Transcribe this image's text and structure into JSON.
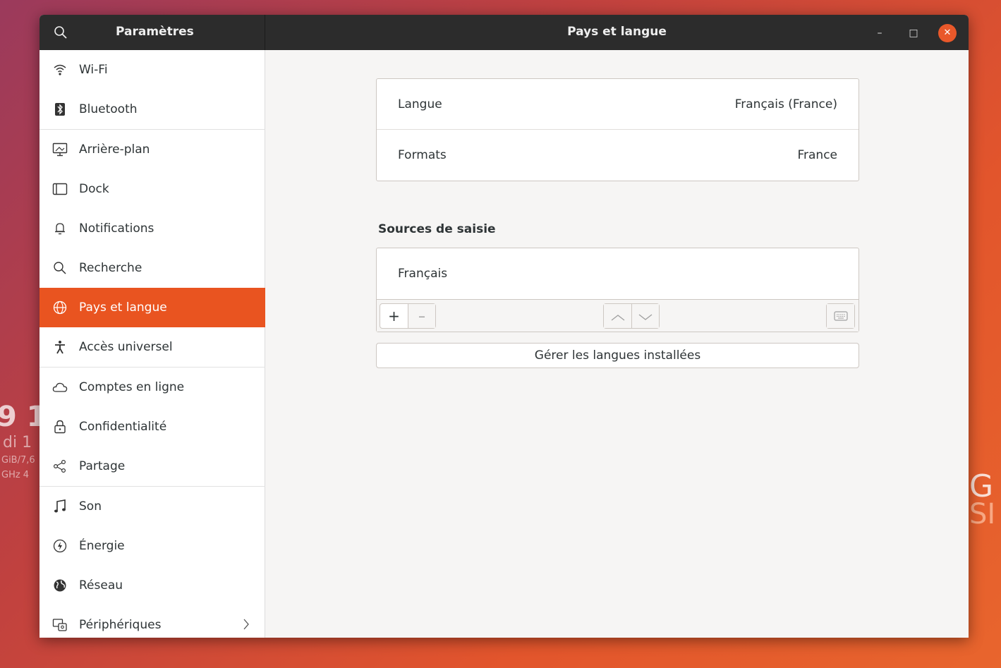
{
  "desktop": {
    "clock_fragment": "9 1",
    "date_fragment": "di 1",
    "mem_fragment": "GiB/7,6",
    "cpu_fragment": "GHz 4",
    "logo_fragment": "G",
    "logo_fragment2": "SI"
  },
  "headerbar": {
    "app_title": "Paramètres",
    "page_title": "Pays et langue",
    "min_label": "–",
    "max_label": "□",
    "close_label": "✕"
  },
  "sidebar": {
    "items": [
      {
        "label": "Wi-Fi",
        "icon": "wifi-icon"
      },
      {
        "label": "Bluetooth",
        "icon": "bluetooth-icon"
      },
      {
        "label": "Arrière-plan",
        "icon": "background-icon"
      },
      {
        "label": "Dock",
        "icon": "dock-icon"
      },
      {
        "label": "Notifications",
        "icon": "bell-icon"
      },
      {
        "label": "Recherche",
        "icon": "search-icon"
      },
      {
        "label": "Pays et langue",
        "icon": "globe-icon",
        "active": true
      },
      {
        "label": "Accès universel",
        "icon": "accessibility-icon"
      },
      {
        "label": "Comptes en ligne",
        "icon": "cloud-icon"
      },
      {
        "label": "Confidentialité",
        "icon": "lock-icon"
      },
      {
        "label": "Partage",
        "icon": "share-icon"
      },
      {
        "label": "Son",
        "icon": "music-note-icon"
      },
      {
        "label": "Énergie",
        "icon": "power-icon"
      },
      {
        "label": "Réseau",
        "icon": "network-globe-icon"
      },
      {
        "label": "Périphériques",
        "icon": "devices-icon"
      }
    ]
  },
  "region": {
    "language_label": "Langue",
    "language_value": "Français (France)",
    "formats_label": "Formats",
    "formats_value": "France",
    "input_sources_title": "Sources de saisie",
    "input_sources": [
      "Français"
    ],
    "add_label": "+",
    "remove_label": "–",
    "manage_label": "Gérer les langues installées"
  },
  "colors": {
    "accent": "#e95420",
    "headerbar": "#2c2c2c"
  }
}
